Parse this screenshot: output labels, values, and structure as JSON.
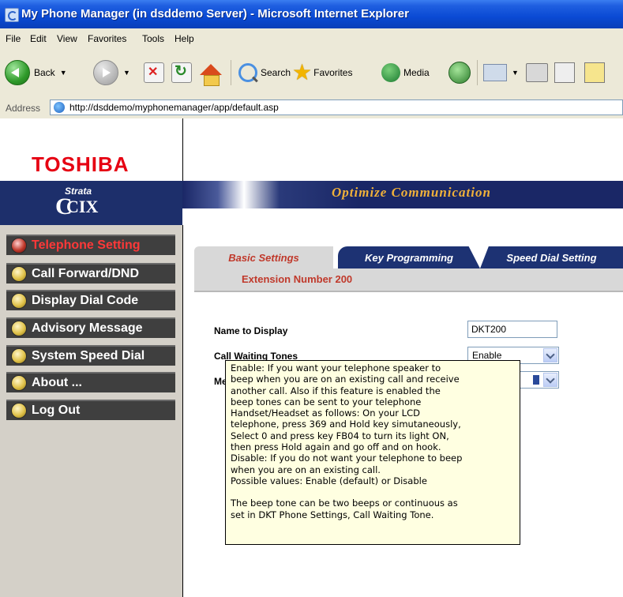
{
  "window": {
    "title": "My Phone Manager (in dsddemo Server) - Microsoft Internet Explorer"
  },
  "menu": [
    "File",
    "Edit",
    "View",
    "Favorites",
    "Tools",
    "Help"
  ],
  "toolbar": {
    "back_label": "Back",
    "search_label": "Search",
    "favorites_label": "Favorites",
    "media_label": "Media"
  },
  "address": {
    "label": "Address",
    "url": "http://dsddemo/myphonemanager/app/default.asp"
  },
  "brand": {
    "logo": "TOSHIBA",
    "product_line": "Strata",
    "product": "CIX",
    "tagline": "Optimize Communication",
    "logo_color": "#e60012"
  },
  "sidebar": {
    "items": [
      {
        "label": "Telephone Setting",
        "active": true
      },
      {
        "label": "Call Forward/DND"
      },
      {
        "label": "Display Dial Code"
      },
      {
        "label": "Advisory Message"
      },
      {
        "label": "System Speed Dial"
      },
      {
        "label": "About ..."
      },
      {
        "label": "Log Out"
      }
    ]
  },
  "tabs": [
    {
      "label": "Basic Settings",
      "active": true
    },
    {
      "label": "Key Programming"
    },
    {
      "label": "Speed Dial Setting"
    }
  ],
  "extension_label": "Extension Number 200",
  "form": {
    "name_label": "Name to Display",
    "name_value": "DKT200",
    "call_waiting_label": "Call Waiting Tones",
    "call_waiting_value": "Enable",
    "third_label_visible": "Me"
  },
  "tooltip": {
    "lines": [
      "Enable: If you want your telephone speaker to",
      "beep when you are on an existing call and receive",
      "another call. Also if this feature is enabled the",
      "beep tones can be sent to your telephone",
      "Handset/Headset as follows: On your LCD",
      "telephone, press 369 and Hold key simutaneously,",
      "Select 0 and press key FB04 to turn its light ON,",
      "then press Hold again and go off and on hook.",
      "Disable: If you do not want your telephone to beep",
      "when you are on an existing call.",
      "Possible values: Enable (default) or Disable",
      "",
      "The beep tone can be two beeps or continuous as",
      "set in DKT Phone Settings, Call Waiting Tone."
    ]
  }
}
